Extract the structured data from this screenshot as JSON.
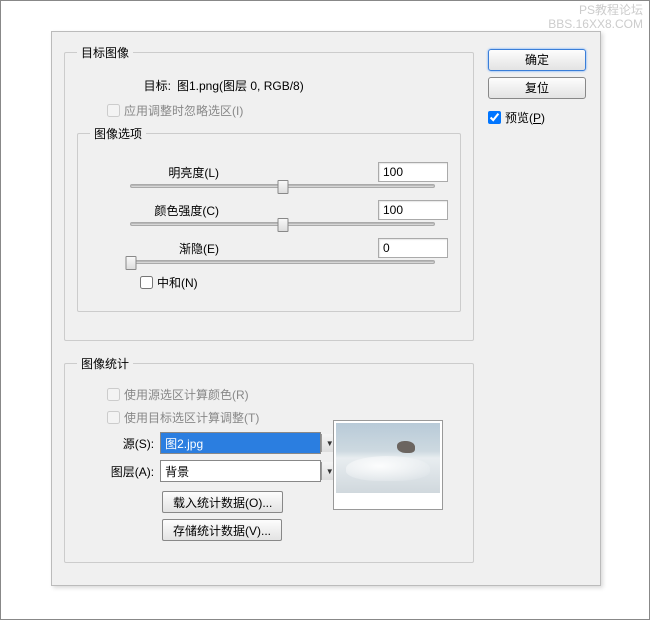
{
  "watermark": {
    "line1": "PS教程论坛",
    "line2": "BBS.16XX8.COM"
  },
  "buttons": {
    "ok": "确定",
    "reset": "复位"
  },
  "preview": {
    "label": "预览(P)",
    "underline": "P",
    "checked": true
  },
  "targetImage": {
    "legend": "目标图像",
    "targetLabel": "目标:",
    "targetValue": "图1.png(图层 0, RGB/8)",
    "ignoreSel": {
      "label": "应用调整时忽略选区(I)",
      "checked": false
    }
  },
  "imageOptions": {
    "legend": "图像选项",
    "luminance": {
      "label": "明亮度(L)",
      "value": "100",
      "pos": 50
    },
    "colorIntensity": {
      "label": "颜色强度(C)",
      "value": "100",
      "pos": 50
    },
    "fade": {
      "label": "渐隐(E)",
      "value": "0",
      "pos": 0
    },
    "neutralize": {
      "label": "中和(N)",
      "checked": false
    }
  },
  "imageStats": {
    "legend": "图像统计",
    "useSrcSel": {
      "label": "使用源选区计算颜色(R)",
      "checked": false
    },
    "useTgtSel": {
      "label": "使用目标选区计算调整(T)",
      "checked": false
    },
    "sourceLabel": "源(S):",
    "sourceValue": "图2.jpg",
    "layerLabel": "图层(A):",
    "layerValue": "背景",
    "loadBtn": "载入统计数据(O)...",
    "saveBtn": "存储统计数据(V)..."
  }
}
